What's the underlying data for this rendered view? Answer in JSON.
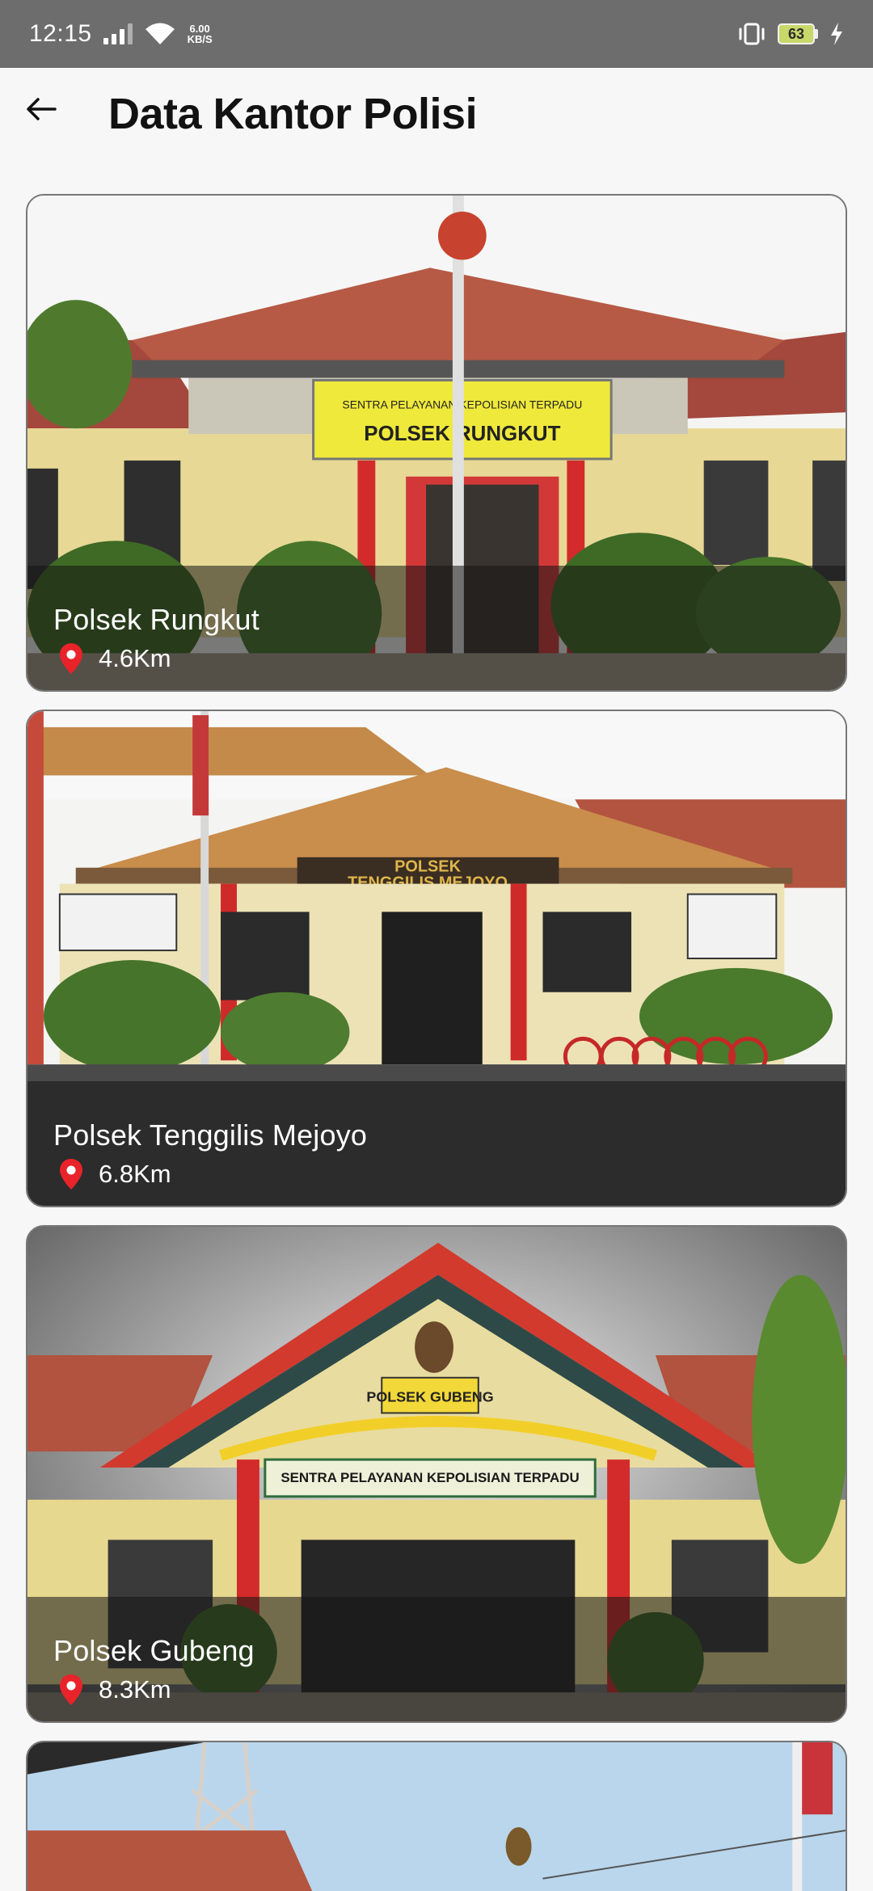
{
  "status_bar": {
    "time": "12:15",
    "net_speed_value": "6.00",
    "net_speed_unit": "KB/S",
    "battery": "63"
  },
  "app_bar": {
    "title": "Data Kantor Polisi",
    "back_icon": "arrow-left-icon"
  },
  "stations": [
    {
      "name": "Polsek Rungkut",
      "distance": "4.6Km",
      "sign_top": "SENTRA PELAYANAN KEPOLISIAN TERPADU",
      "sign_main": "POLSEK RUNGKUT"
    },
    {
      "name": "Polsek Tenggilis Mejoyo",
      "distance": "6.8Km",
      "sign_top": "POLSEK",
      "sign_main": "TENGGILIS MEJOYO"
    },
    {
      "name": "Polsek Gubeng",
      "distance": "8.3Km",
      "sign_top": "POLSEK GUBENG",
      "sign_main": "SENTRA PELAYANAN KEPOLISIAN TERPADU"
    },
    {
      "name": "",
      "distance": ""
    }
  ],
  "colors": {
    "pin": "#e8232a",
    "status_bar": "#6d6d6d",
    "background": "#f7f7f7"
  }
}
